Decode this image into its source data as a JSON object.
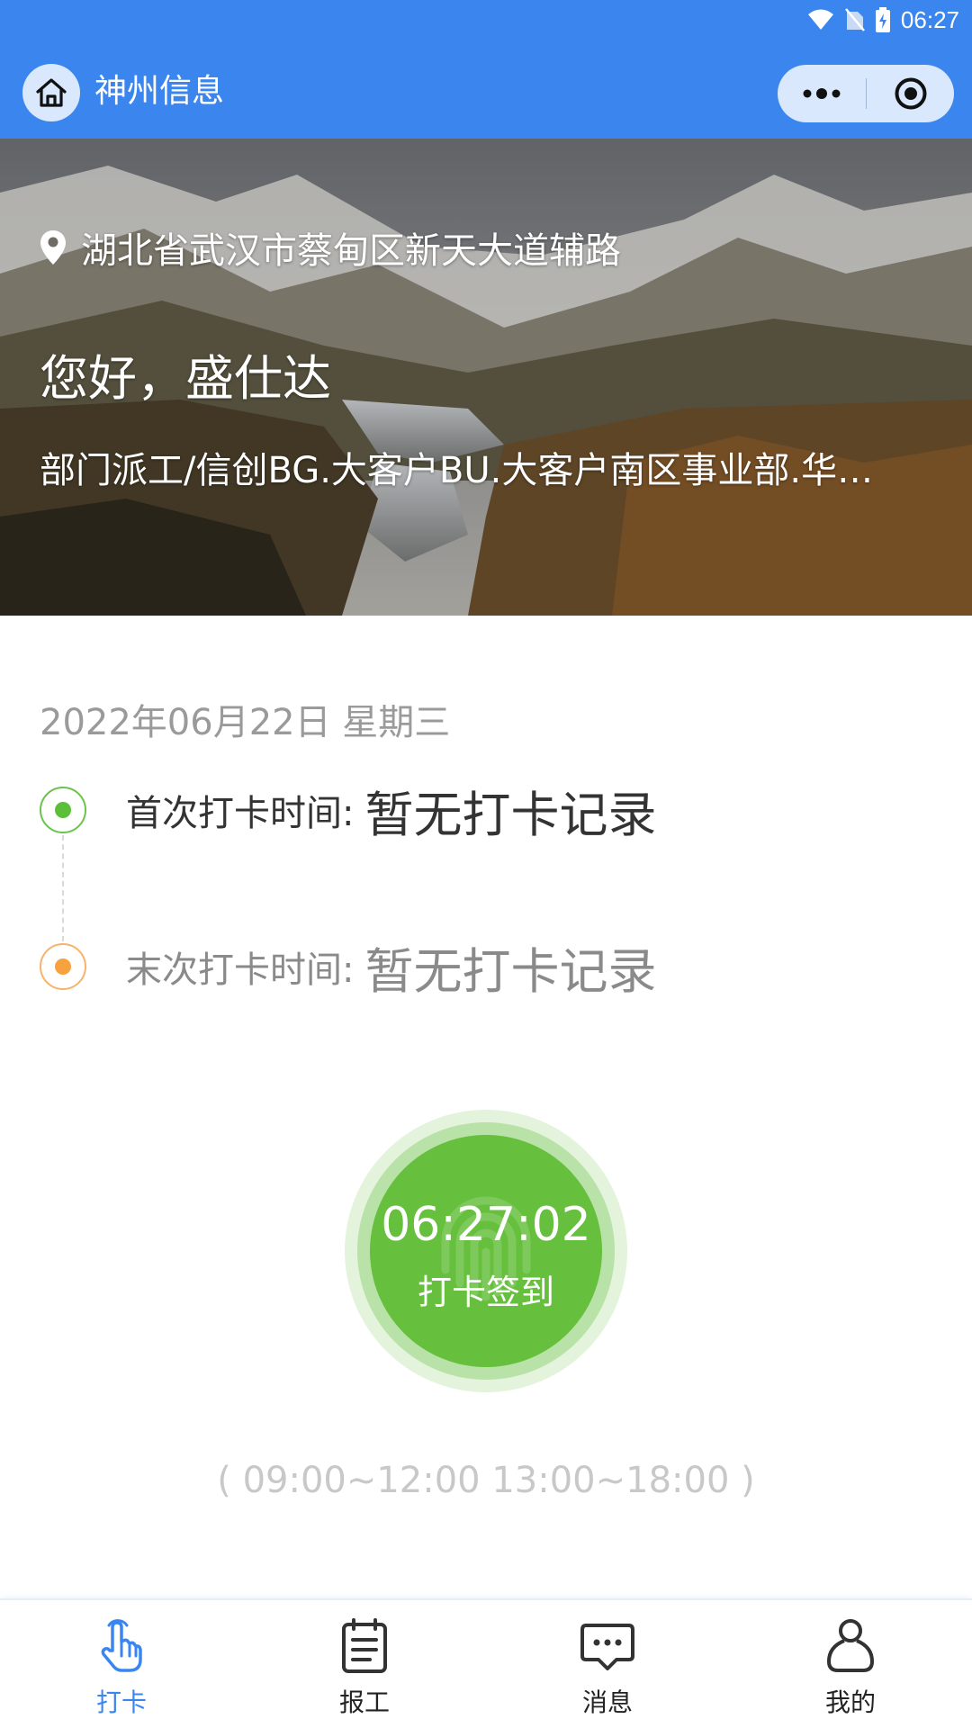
{
  "status_bar": {
    "time": "06:27",
    "icons": [
      "wifi-icon",
      "no-sim-icon",
      "battery-charging-icon"
    ]
  },
  "nav": {
    "title": "神州信息",
    "icons": [
      "home-icon",
      "more-dots-icon",
      "close-target-icon"
    ]
  },
  "hero": {
    "location": "湖北省武汉市蔡甸区新天大道辅路",
    "greeting": "您好，盛仕达",
    "department": "部门派工/信创BG.大客户BU.大客户南区事业部.华…"
  },
  "date": "2022年06月22日 星期三",
  "records": {
    "first": {
      "label": "首次打卡时间:",
      "value": "暂无打卡记录"
    },
    "last": {
      "label": "末次打卡时间:",
      "value": "暂无打卡记录"
    }
  },
  "punch": {
    "time": "06:27:02",
    "label": "打卡签到"
  },
  "work_hours": "( 09:00~12:00 13:00~18:00 )",
  "tabs": [
    {
      "label": "打卡",
      "icon": "tap-finger-icon",
      "active": true
    },
    {
      "label": "报工",
      "icon": "clipboard-icon",
      "active": false
    },
    {
      "label": "消息",
      "icon": "message-icon",
      "active": false
    },
    {
      "label": "我的",
      "icon": "profile-icon",
      "active": false
    }
  ],
  "colors": {
    "primary": "#3b86ee",
    "punch_green": "#66bf3d",
    "first_dot": "#5bbf3a",
    "last_dot": "#f7a23e"
  }
}
